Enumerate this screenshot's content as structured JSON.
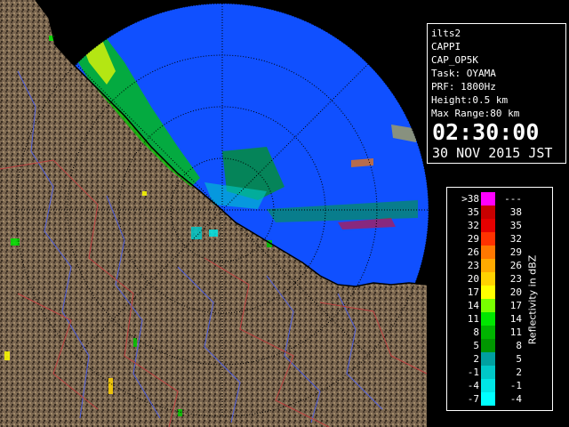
{
  "info": {
    "site": "ilts2",
    "product": "CAPPI",
    "product_code": "CAP_OP5K",
    "task": "Task: OYAMA",
    "prf": "PRF: 1800Hz",
    "height": "Height:0.5 km",
    "max_range": "Max Range:80 km",
    "time": "02:30:00",
    "date": "30 NOV 2015 JST"
  },
  "legend": {
    "unit": "Reflectivity in dBZ",
    "rows": [
      {
        "lo": ">38",
        "hi": "---",
        "color": "#ff00ff"
      },
      {
        "lo": "35",
        "hi": "38",
        "color": "#c80000"
      },
      {
        "lo": "32",
        "hi": "35",
        "color": "#e60000"
      },
      {
        "lo": "29",
        "hi": "32",
        "color": "#ff3200"
      },
      {
        "lo": "26",
        "hi": "29",
        "color": "#ff7800"
      },
      {
        "lo": "23",
        "hi": "26",
        "color": "#ffaa00"
      },
      {
        "lo": "20",
        "hi": "23",
        "color": "#ffd200"
      },
      {
        "lo": "17",
        "hi": "20",
        "color": "#ffff00"
      },
      {
        "lo": "14",
        "hi": "17",
        "color": "#78ff00"
      },
      {
        "lo": "11",
        "hi": "14",
        "color": "#00e600"
      },
      {
        "lo": "8",
        "hi": "11",
        "color": "#00b400"
      },
      {
        "lo": "5",
        "hi": "8",
        "color": "#009600"
      },
      {
        "lo": "2",
        "hi": "5",
        "color": "#00a0a0"
      },
      {
        "lo": "-1",
        "hi": "2",
        "color": "#00c8c8"
      },
      {
        "lo": "-4",
        "hi": "-1",
        "color": "#00e6e6"
      },
      {
        "lo": "-7",
        "hi": "-4",
        "color": "#00ffff"
      }
    ]
  },
  "colors": {
    "sea": "#1050ff",
    "land": "#7a6650",
    "land_dark": "#3a2e22",
    "rivers": "#5060e0",
    "boundaries": "#c04040"
  }
}
